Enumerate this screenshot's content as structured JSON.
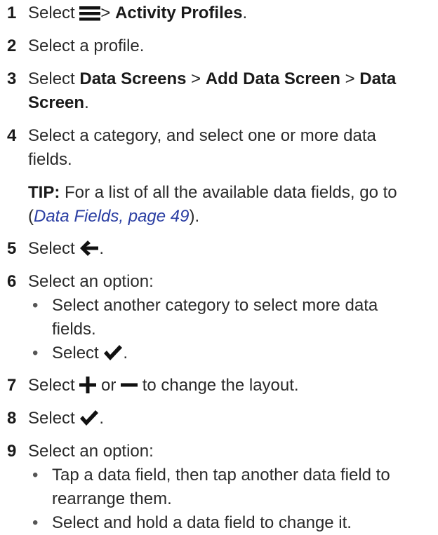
{
  "steps": [
    {
      "num": "1",
      "pre": "Select",
      "sep": ">",
      "bold": "Activity Profiles",
      "post": "."
    },
    {
      "num": "2",
      "text": "Select a profile."
    },
    {
      "num": "3",
      "pre": "Select",
      "b1": "Data Screens",
      "sep1": ">",
      "b2": "Add Data Screen",
      "sep2": ">",
      "b3": "Data",
      "b3b": "Screen",
      "post": "."
    },
    {
      "num": "4",
      "line1": "Select a category, and select one or more data",
      "line2": "fields."
    },
    {
      "tip_label": "TIP:",
      "tip_line1": " For a list of all the available data fields, go to",
      "tip_open": "(",
      "tip_link": "Data Fields, page 49",
      "tip_close": ")."
    },
    {
      "num": "5",
      "pre": "Select",
      "post": "."
    },
    {
      "num": "6",
      "text": "Select an option:",
      "bullets": [
        {
          "line1": "Select another category to select more data",
          "line2": "fields."
        },
        {
          "pre": "Select",
          "post": "."
        }
      ]
    },
    {
      "num": "7",
      "pre": "Select",
      "mid": "or",
      "post": "to change the layout."
    },
    {
      "num": "8",
      "pre": "Select",
      "post": "."
    },
    {
      "num": "9",
      "text": "Select an option:",
      "bullets": [
        {
          "line1": "Tap a data field, then tap another data field to",
          "line2": "rearrange them."
        },
        {
          "text": "Select and hold a data field to change it."
        }
      ]
    }
  ],
  "bullet_char": "•",
  "icons": [
    "menu-icon",
    "back-arrow-icon",
    "checkmark-icon",
    "plus-icon",
    "minus-icon"
  ]
}
